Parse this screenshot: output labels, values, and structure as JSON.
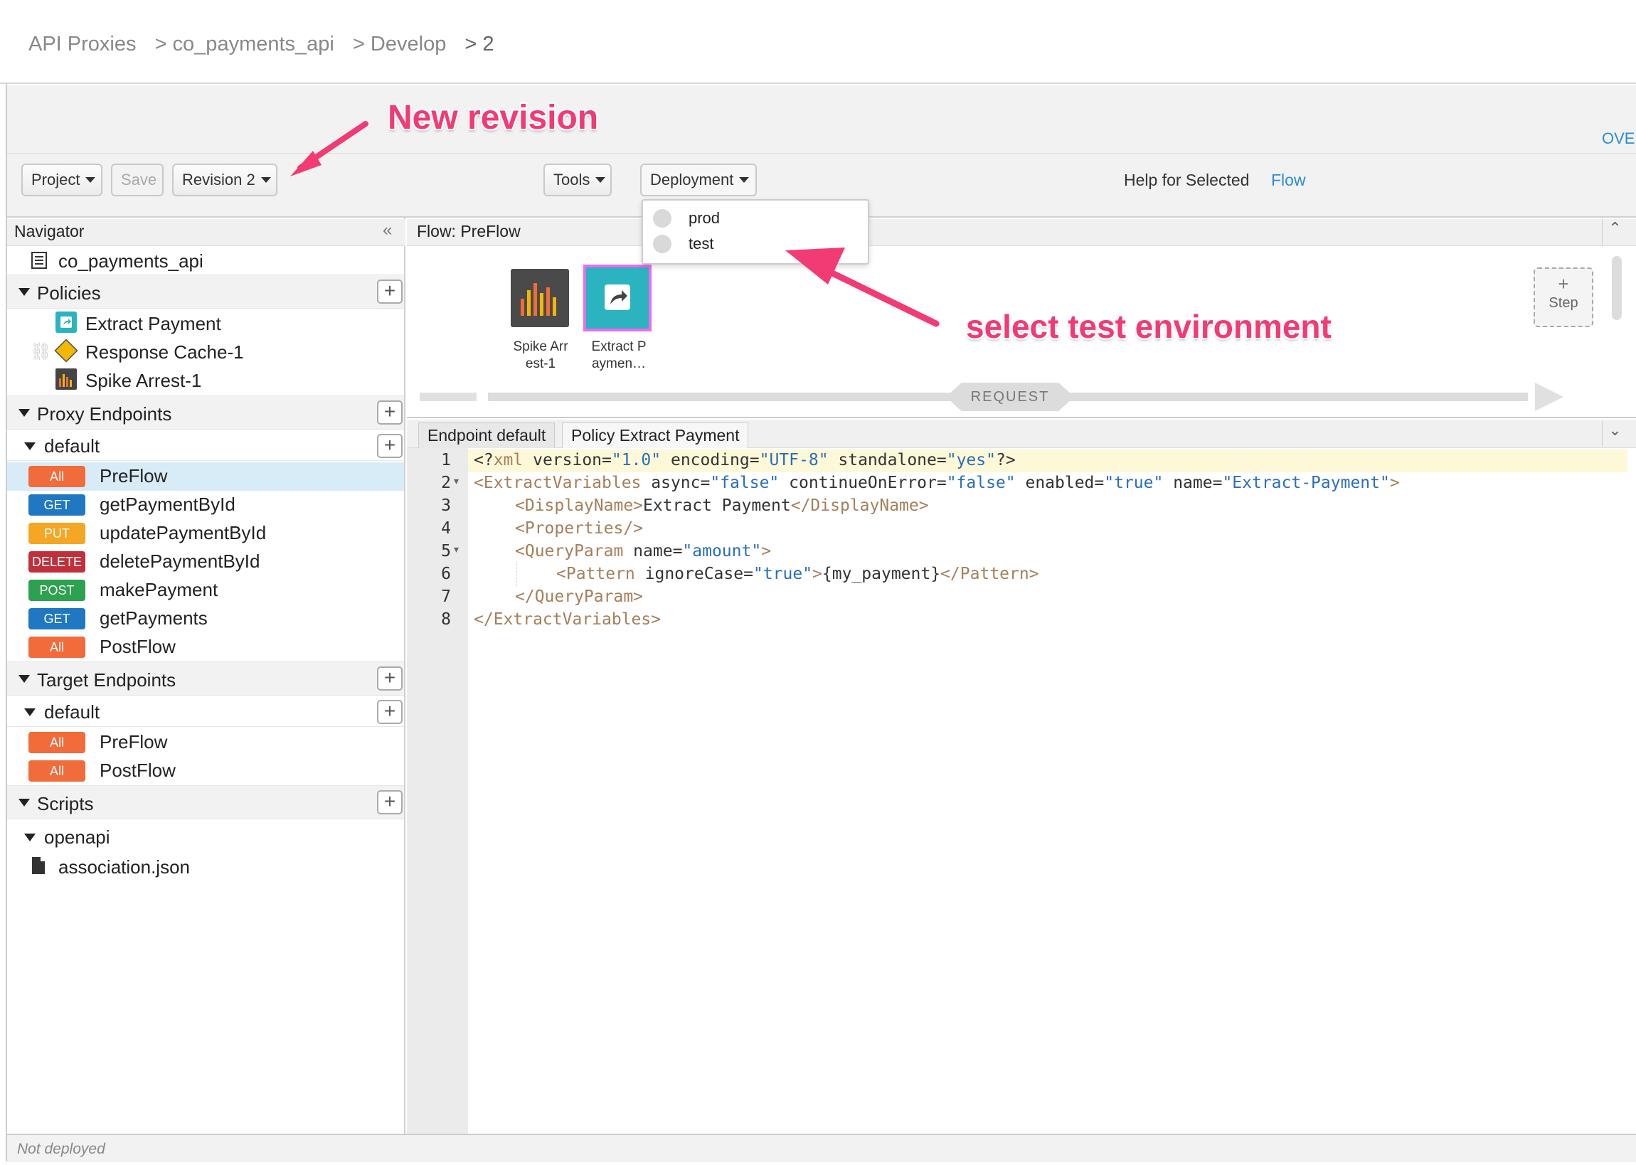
{
  "breadcrumb": [
    {
      "label": "API Proxies"
    },
    {
      "label": "> co_payments_api"
    },
    {
      "label": "> Develop"
    },
    {
      "label": "> 2"
    }
  ],
  "toolbar": {
    "project": "Project",
    "save": "Save",
    "revision": "Revision 2",
    "tools": "Tools",
    "deployment": "Deployment",
    "help_text": "Help for Selected",
    "help_link": "Flow",
    "overview": "OVE"
  },
  "deployment_menu": {
    "items": [
      "prod",
      "test"
    ]
  },
  "navigator": {
    "title": "Navigator",
    "proxy_name": "co_payments_api",
    "policies_label": "Policies",
    "policies": [
      "Extract Payment",
      "Response Cache-1",
      "Spike Arrest-1"
    ],
    "proxy_endpoints_label": "Proxy Endpoints",
    "proxy_default": "default",
    "proxy_flows": [
      {
        "verb": "All",
        "name": "PreFlow"
      },
      {
        "verb": "GET",
        "name": "getPaymentById"
      },
      {
        "verb": "PUT",
        "name": "updatePaymentById"
      },
      {
        "verb": "DELETE",
        "name": "deletePaymentById"
      },
      {
        "verb": "POST",
        "name": "makePayment"
      },
      {
        "verb": "GET",
        "name": "getPayments"
      },
      {
        "verb": "All",
        "name": "PostFlow"
      }
    ],
    "target_endpoints_label": "Target Endpoints",
    "target_default": "default",
    "target_flows": [
      {
        "verb": "All",
        "name": "PreFlow"
      },
      {
        "verb": "All",
        "name": "PostFlow"
      }
    ],
    "scripts_label": "Scripts",
    "openapi": "openapi",
    "file": "association.json"
  },
  "flow": {
    "title": "Flow: PreFlow",
    "policy1": [
      "Spike Arr",
      "est-1"
    ],
    "policy2": [
      "Extract P",
      "aymen…"
    ],
    "step_plus": "+",
    "step_label": "Step",
    "request_label": "REQUEST"
  },
  "tabs": [
    "Endpoint default",
    "Policy Extract Payment"
  ],
  "code_lines": [
    "1",
    "2",
    "3",
    "4",
    "5",
    "6",
    "7",
    "8"
  ],
  "code": {
    "l1": [
      "<?",
      "xml",
      " version=",
      "\"1.0\"",
      " encoding=",
      "\"UTF-8\"",
      " standalone=",
      "\"yes\"",
      "?>"
    ],
    "l2": [
      "<ExtractVariables",
      " async=",
      "\"false\"",
      " continueOnError=",
      "\"false\"",
      " enabled=",
      "\"true\"",
      " name=",
      "\"Extract-Payment\"",
      ">"
    ],
    "l3": [
      "<DisplayName>",
      "Extract Payment",
      "</DisplayName>"
    ],
    "l4": [
      "<Properties/>"
    ],
    "l5": [
      "<QueryParam",
      " name=",
      "\"amount\"",
      ">"
    ],
    "l6": [
      "<Pattern",
      " ignoreCase=",
      "\"true\"",
      ">",
      "{my_payment}",
      "</Pattern>"
    ],
    "l7": [
      "</QueryParam>"
    ],
    "l8": [
      "</ExtractVariables>"
    ]
  },
  "status": "Not deployed",
  "annotations": {
    "new_revision": "New revision",
    "select_test": "select test environment"
  },
  "colors": {
    "accent": "#2a8fd1",
    "annotation": "#f23a74"
  }
}
